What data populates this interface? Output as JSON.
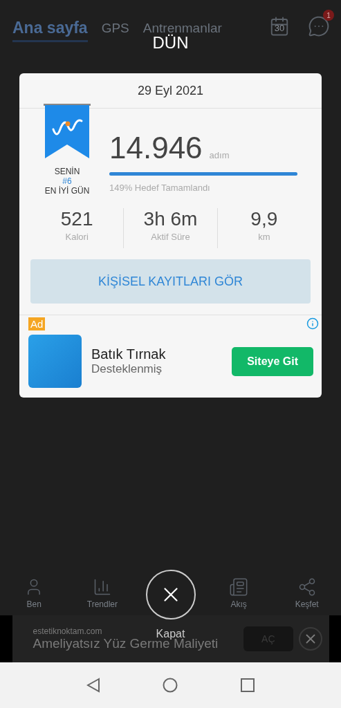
{
  "background": {
    "tabs": [
      {
        "label": "Ana sayfa",
        "selected": true
      },
      {
        "label": "GPS",
        "selected": false
      },
      {
        "label": "Antrenmanlar",
        "selected": false
      }
    ],
    "calendar_day": "30",
    "message_badge": "1",
    "bottom_nav": [
      {
        "label": "Ben"
      },
      {
        "label": "Trendler"
      },
      {
        "label": "Akış"
      },
      {
        "label": "Keşfet"
      }
    ],
    "banner_ad": {
      "domain": "estetiknoktam.com",
      "title": "Ameliyatsız Yüz Germe Maliyeti",
      "button": "AÇ"
    }
  },
  "dialog": {
    "title": "DÜN",
    "date": "29 Eyl 2021",
    "badge": {
      "line1": "SENİN",
      "rank": "#6",
      "line2": "EN İYİ GÜN"
    },
    "steps": "14.946",
    "steps_unit": "adım",
    "progress": {
      "level": 1,
      "label": "149% Hedef Tamamlandı"
    },
    "stats": [
      {
        "value": "521",
        "label": "Kalori"
      },
      {
        "value": "3h 6m",
        "label": "Aktif Süre"
      },
      {
        "value": "9,9",
        "label": "km"
      }
    ],
    "records_button": "KİŞİSEL KAYITLARI GÖR",
    "ad": {
      "badge": "Ad",
      "title": "Batık Tırnak",
      "subtitle": "Desteklenmiş",
      "button": "Siteye Git"
    },
    "close_label": "Kapat"
  }
}
